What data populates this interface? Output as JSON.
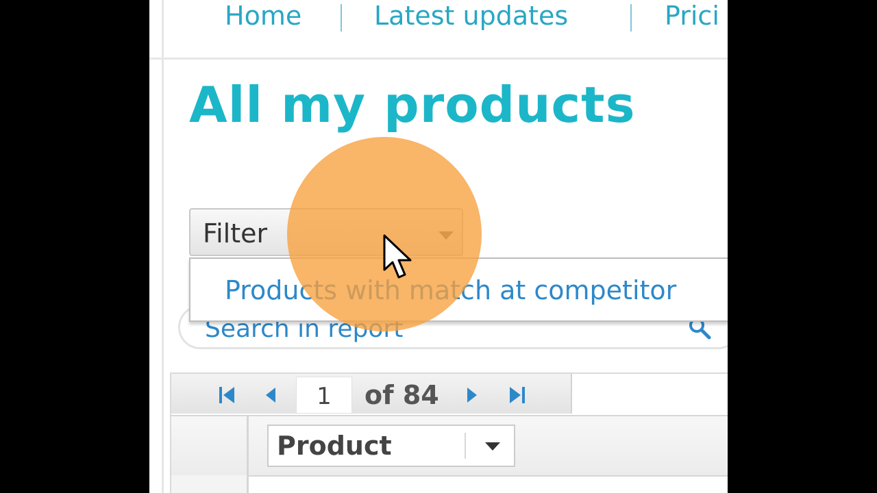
{
  "nav": {
    "items": [
      "Home",
      "Latest updates",
      "Prici"
    ]
  },
  "page": {
    "title": "All my products"
  },
  "filter": {
    "label": "Filter",
    "option": "Products with match at competitor"
  },
  "search": {
    "placeholder": "Search in report"
  },
  "pager": {
    "current_page": "1",
    "of_text": "of 84"
  },
  "table": {
    "column_header": "Product"
  },
  "colors": {
    "accent": "#1cb6c9",
    "link": "#2d88c9",
    "highlight": "#f7a03d"
  }
}
